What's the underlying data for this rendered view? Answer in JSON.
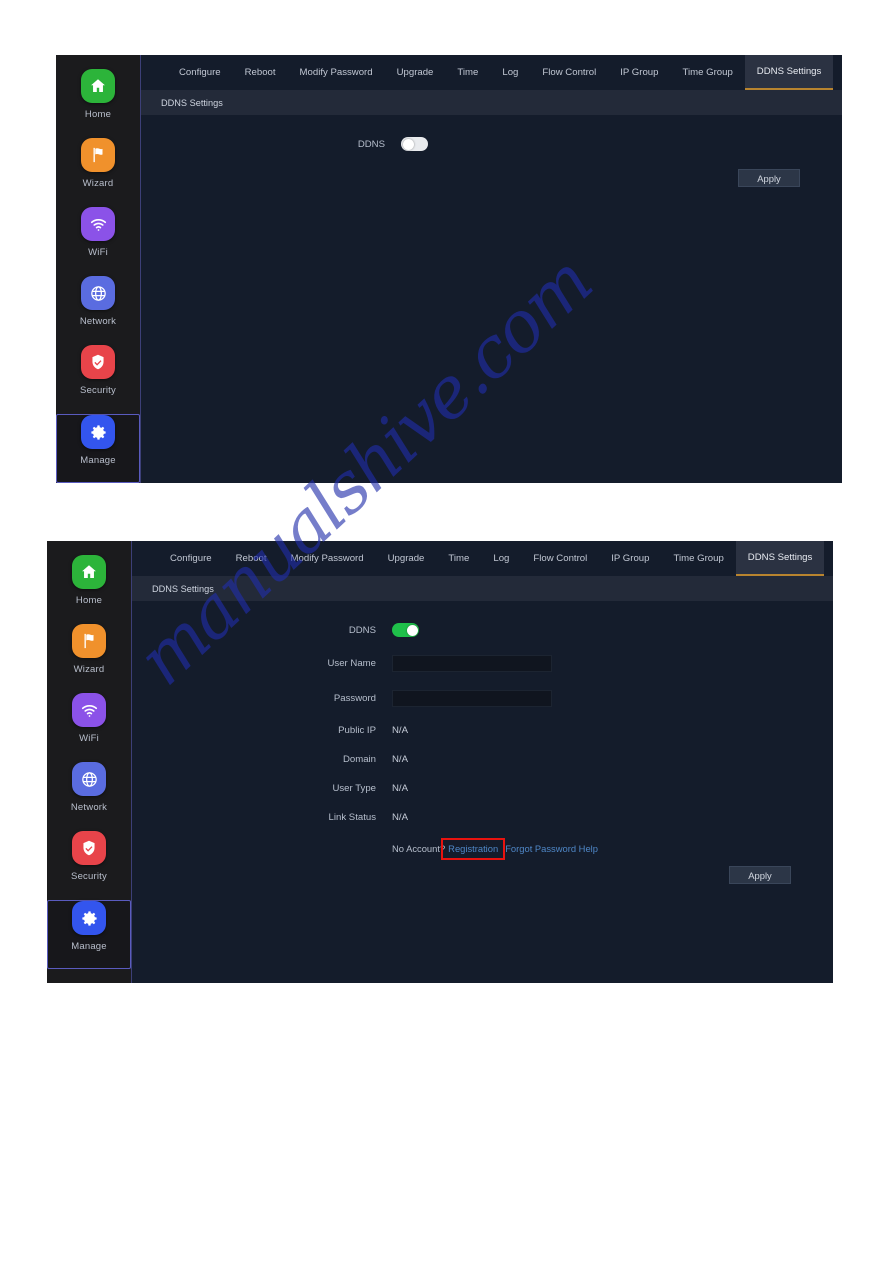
{
  "sidebar": {
    "items": [
      {
        "label": "Home",
        "icon": "home-icon",
        "color": "#2cb43a",
        "active": false
      },
      {
        "label": "Wizard",
        "icon": "flag-icon",
        "color": "#f0912c",
        "active": false
      },
      {
        "label": "WiFi",
        "icon": "wifi-icon",
        "color": "#8b52e8",
        "active": false
      },
      {
        "label": "Network",
        "icon": "globe-icon",
        "color": "#5a6ce0",
        "active": false
      },
      {
        "label": "Security",
        "icon": "shield-icon",
        "color": "#e8444a",
        "active": false
      },
      {
        "label": "Manage",
        "icon": "gear-icon",
        "color": "#3355ee",
        "active": true
      }
    ]
  },
  "tabs": [
    {
      "label": "Configure",
      "active": false
    },
    {
      "label": "Reboot",
      "active": false
    },
    {
      "label": "Modify Password",
      "active": false
    },
    {
      "label": "Upgrade",
      "active": false
    },
    {
      "label": "Time",
      "active": false
    },
    {
      "label": "Log",
      "active": false
    },
    {
      "label": "Flow Control",
      "active": false
    },
    {
      "label": "IP Group",
      "active": false
    },
    {
      "label": "Time Group",
      "active": false
    },
    {
      "label": "DDNS Settings",
      "active": true
    }
  ],
  "breadcrumb": "DDNS Settings",
  "panel_off": {
    "ddns_label": "DDNS",
    "ddns_state": "off",
    "apply_label": "Apply"
  },
  "panel_on": {
    "ddns_label": "DDNS",
    "ddns_state": "on",
    "username_label": "User Name",
    "username_value": "",
    "password_label": "Password",
    "password_value": "",
    "public_ip_label": "Public IP",
    "public_ip_value": "N/A",
    "domain_label": "Domain",
    "domain_value": "N/A",
    "user_type_label": "User Type",
    "user_type_value": "N/A",
    "link_status_label": "Link Status",
    "link_status_value": "N/A",
    "no_account_text": "No Account?",
    "registration_link": "Registration",
    "forgot_link": "Forgot Password Help",
    "apply_label": "Apply"
  },
  "watermark": "manualshive.com",
  "colors": {
    "accent_tab": "#b8842f",
    "toggle_on": "#1fc04a",
    "highlight_box": "#e8130f",
    "link": "#4f87c7",
    "panel_bg": "#141c2b",
    "sidebar_bg": "#1b1b1d"
  }
}
